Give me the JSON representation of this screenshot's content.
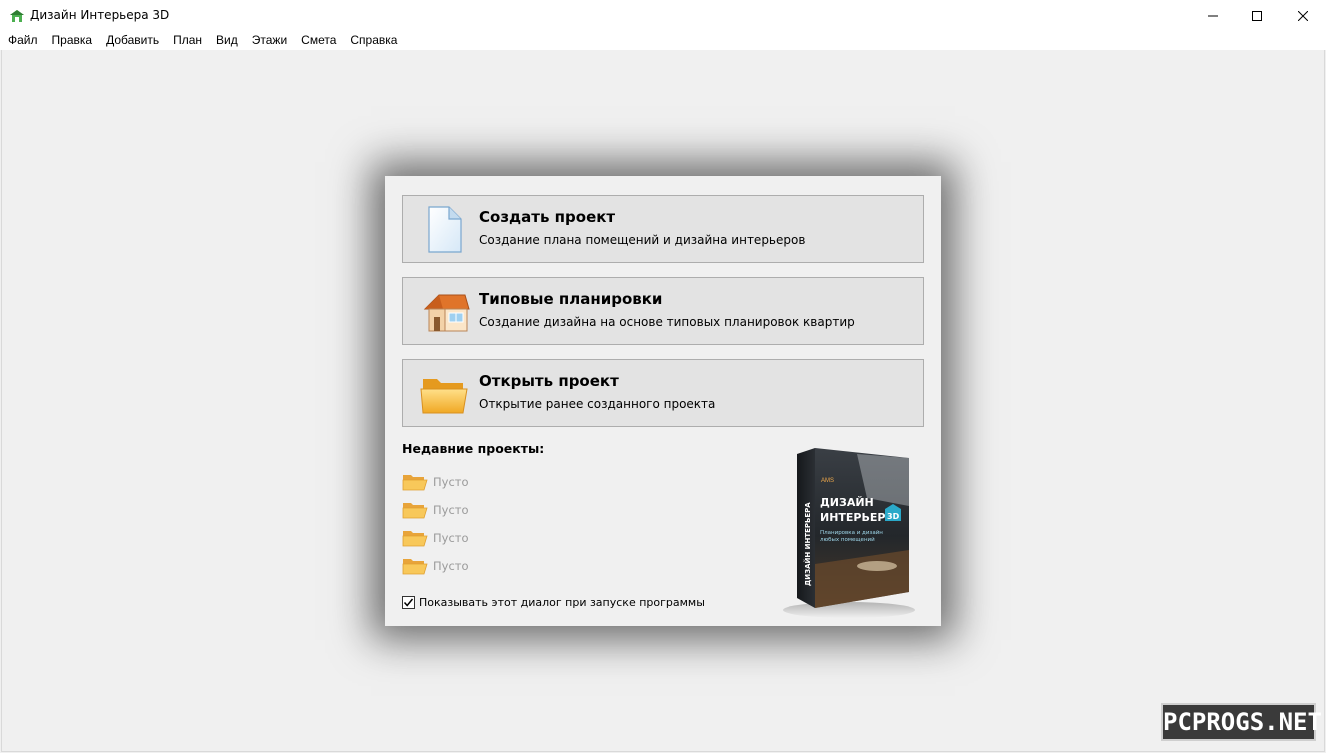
{
  "window": {
    "title": "Дизайн Интерьера 3D"
  },
  "menu": [
    "Файл",
    "Правка",
    "Добавить",
    "План",
    "Вид",
    "Этажи",
    "Смета",
    "Справка"
  ],
  "dialog": {
    "actions": [
      {
        "title": "Создать проект",
        "description": "Создание плана помещений и дизайна интерьеров",
        "icon": "new-document-icon"
      },
      {
        "title": "Типовые планировки",
        "description": "Создание дизайна на основе типовых планировок квартир",
        "icon": "house-icon"
      },
      {
        "title": "Открыть проект",
        "description": "Открытие ранее созданного проекта",
        "icon": "open-folder-icon"
      }
    ],
    "recent": {
      "heading": "Недавние проекты:",
      "items": [
        "Пусто",
        "Пусто",
        "Пусто",
        "Пусто"
      ]
    },
    "show_on_startup": {
      "label": "Показывать этот диалог при запуске программы",
      "checked": true
    },
    "product_box": {
      "brand": "AMS",
      "title_line1": "ДИЗАЙН",
      "title_line2": "ИНТЕРЬЕРА",
      "badge": "3D",
      "subtitle_line1": "Планировка и дизайн",
      "subtitle_line2": "любых помещений",
      "spine": "ДИЗАЙН ИНТЕРЬЕРА"
    }
  },
  "watermark": "PCPROGS.NET",
  "colors": {
    "dialog_bg": "#f0f0f0",
    "button_bg": "#e3e3e3",
    "button_border": "#adadad",
    "folder": "#f5b731",
    "roof": "#e0742a"
  }
}
